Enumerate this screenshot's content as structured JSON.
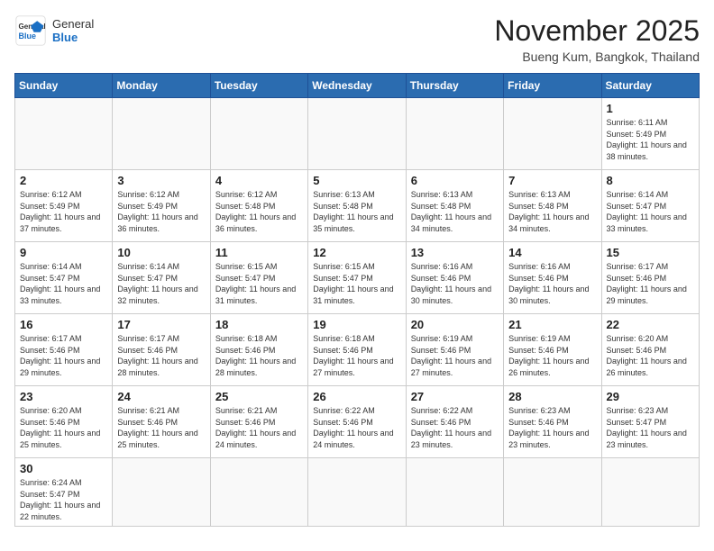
{
  "header": {
    "logo_general": "General",
    "logo_blue": "Blue",
    "month_title": "November 2025",
    "location": "Bueng Kum, Bangkok, Thailand"
  },
  "weekdays": [
    "Sunday",
    "Monday",
    "Tuesday",
    "Wednesday",
    "Thursday",
    "Friday",
    "Saturday"
  ],
  "days": {
    "d1": {
      "num": "1",
      "sunrise": "Sunrise: 6:11 AM",
      "sunset": "Sunset: 5:49 PM",
      "daylight": "Daylight: 11 hours and 38 minutes."
    },
    "d2": {
      "num": "2",
      "sunrise": "Sunrise: 6:12 AM",
      "sunset": "Sunset: 5:49 PM",
      "daylight": "Daylight: 11 hours and 37 minutes."
    },
    "d3": {
      "num": "3",
      "sunrise": "Sunrise: 6:12 AM",
      "sunset": "Sunset: 5:49 PM",
      "daylight": "Daylight: 11 hours and 36 minutes."
    },
    "d4": {
      "num": "4",
      "sunrise": "Sunrise: 6:12 AM",
      "sunset": "Sunset: 5:48 PM",
      "daylight": "Daylight: 11 hours and 36 minutes."
    },
    "d5": {
      "num": "5",
      "sunrise": "Sunrise: 6:13 AM",
      "sunset": "Sunset: 5:48 PM",
      "daylight": "Daylight: 11 hours and 35 minutes."
    },
    "d6": {
      "num": "6",
      "sunrise": "Sunrise: 6:13 AM",
      "sunset": "Sunset: 5:48 PM",
      "daylight": "Daylight: 11 hours and 34 minutes."
    },
    "d7": {
      "num": "7",
      "sunrise": "Sunrise: 6:13 AM",
      "sunset": "Sunset: 5:48 PM",
      "daylight": "Daylight: 11 hours and 34 minutes."
    },
    "d8": {
      "num": "8",
      "sunrise": "Sunrise: 6:14 AM",
      "sunset": "Sunset: 5:47 PM",
      "daylight": "Daylight: 11 hours and 33 minutes."
    },
    "d9": {
      "num": "9",
      "sunrise": "Sunrise: 6:14 AM",
      "sunset": "Sunset: 5:47 PM",
      "daylight": "Daylight: 11 hours and 33 minutes."
    },
    "d10": {
      "num": "10",
      "sunrise": "Sunrise: 6:14 AM",
      "sunset": "Sunset: 5:47 PM",
      "daylight": "Daylight: 11 hours and 32 minutes."
    },
    "d11": {
      "num": "11",
      "sunrise": "Sunrise: 6:15 AM",
      "sunset": "Sunset: 5:47 PM",
      "daylight": "Daylight: 11 hours and 31 minutes."
    },
    "d12": {
      "num": "12",
      "sunrise": "Sunrise: 6:15 AM",
      "sunset": "Sunset: 5:47 PM",
      "daylight": "Daylight: 11 hours and 31 minutes."
    },
    "d13": {
      "num": "13",
      "sunrise": "Sunrise: 6:16 AM",
      "sunset": "Sunset: 5:46 PM",
      "daylight": "Daylight: 11 hours and 30 minutes."
    },
    "d14": {
      "num": "14",
      "sunrise": "Sunrise: 6:16 AM",
      "sunset": "Sunset: 5:46 PM",
      "daylight": "Daylight: 11 hours and 30 minutes."
    },
    "d15": {
      "num": "15",
      "sunrise": "Sunrise: 6:17 AM",
      "sunset": "Sunset: 5:46 PM",
      "daylight": "Daylight: 11 hours and 29 minutes."
    },
    "d16": {
      "num": "16",
      "sunrise": "Sunrise: 6:17 AM",
      "sunset": "Sunset: 5:46 PM",
      "daylight": "Daylight: 11 hours and 29 minutes."
    },
    "d17": {
      "num": "17",
      "sunrise": "Sunrise: 6:17 AM",
      "sunset": "Sunset: 5:46 PM",
      "daylight": "Daylight: 11 hours and 28 minutes."
    },
    "d18": {
      "num": "18",
      "sunrise": "Sunrise: 6:18 AM",
      "sunset": "Sunset: 5:46 PM",
      "daylight": "Daylight: 11 hours and 28 minutes."
    },
    "d19": {
      "num": "19",
      "sunrise": "Sunrise: 6:18 AM",
      "sunset": "Sunset: 5:46 PM",
      "daylight": "Daylight: 11 hours and 27 minutes."
    },
    "d20": {
      "num": "20",
      "sunrise": "Sunrise: 6:19 AM",
      "sunset": "Sunset: 5:46 PM",
      "daylight": "Daylight: 11 hours and 27 minutes."
    },
    "d21": {
      "num": "21",
      "sunrise": "Sunrise: 6:19 AM",
      "sunset": "Sunset: 5:46 PM",
      "daylight": "Daylight: 11 hours and 26 minutes."
    },
    "d22": {
      "num": "22",
      "sunrise": "Sunrise: 6:20 AM",
      "sunset": "Sunset: 5:46 PM",
      "daylight": "Daylight: 11 hours and 26 minutes."
    },
    "d23": {
      "num": "23",
      "sunrise": "Sunrise: 6:20 AM",
      "sunset": "Sunset: 5:46 PM",
      "daylight": "Daylight: 11 hours and 25 minutes."
    },
    "d24": {
      "num": "24",
      "sunrise": "Sunrise: 6:21 AM",
      "sunset": "Sunset: 5:46 PM",
      "daylight": "Daylight: 11 hours and 25 minutes."
    },
    "d25": {
      "num": "25",
      "sunrise": "Sunrise: 6:21 AM",
      "sunset": "Sunset: 5:46 PM",
      "daylight": "Daylight: 11 hours and 24 minutes."
    },
    "d26": {
      "num": "26",
      "sunrise": "Sunrise: 6:22 AM",
      "sunset": "Sunset: 5:46 PM",
      "daylight": "Daylight: 11 hours and 24 minutes."
    },
    "d27": {
      "num": "27",
      "sunrise": "Sunrise: 6:22 AM",
      "sunset": "Sunset: 5:46 PM",
      "daylight": "Daylight: 11 hours and 23 minutes."
    },
    "d28": {
      "num": "28",
      "sunrise": "Sunrise: 6:23 AM",
      "sunset": "Sunset: 5:46 PM",
      "daylight": "Daylight: 11 hours and 23 minutes."
    },
    "d29": {
      "num": "29",
      "sunrise": "Sunrise: 6:23 AM",
      "sunset": "Sunset: 5:47 PM",
      "daylight": "Daylight: 11 hours and 23 minutes."
    },
    "d30": {
      "num": "30",
      "sunrise": "Sunrise: 6:24 AM",
      "sunset": "Sunset: 5:47 PM",
      "daylight": "Daylight: 11 hours and 22 minutes."
    }
  }
}
